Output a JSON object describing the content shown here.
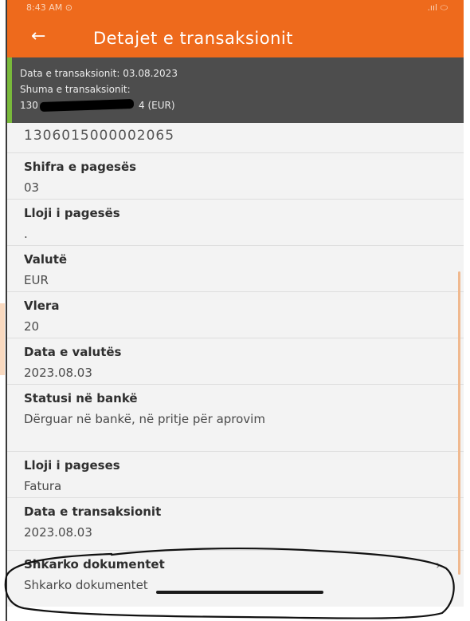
{
  "status_bar": {
    "time": "8:43 AM ⊙",
    "icons": ".ııl ⬭"
  },
  "app_bar": {
    "back_icon": "arrow-left-icon",
    "title": "Detajet e transaksionit"
  },
  "summary": {
    "date_line": "Data e transaksionit: 03.08.2023",
    "amount_label": "Shuma e transaksionit:",
    "amount_head": "130",
    "amount_tail": "4 (EUR)"
  },
  "partial_row": {
    "value": "1306015000002065"
  },
  "details": [
    {
      "label": "Shifra e pagesës",
      "value": "03"
    },
    {
      "label": "Lloji i pagesës",
      "value": "."
    },
    {
      "label": "Valutë",
      "value": "EUR"
    },
    {
      "label": "Vlera",
      "value": "20"
    },
    {
      "label": "Data e valutës",
      "value": "2023.08.03"
    },
    {
      "label": "Statusi në bankë",
      "value": "Dërguar në bankë, në pritje për aprovim"
    },
    {
      "label": "Lloji i pageses",
      "value": "Fatura"
    },
    {
      "label": "Data e transaksionit",
      "value": "2023.08.03"
    }
  ],
  "download": {
    "label": "Shkarko dokumentet",
    "value": "Shkarko dokumentet",
    "chevron_icon": "chevron-right-icon"
  },
  "colors": {
    "accent": "#ee6a1c",
    "summary_bg": "#4d4d4d",
    "summary_accent": "#79b93b"
  }
}
